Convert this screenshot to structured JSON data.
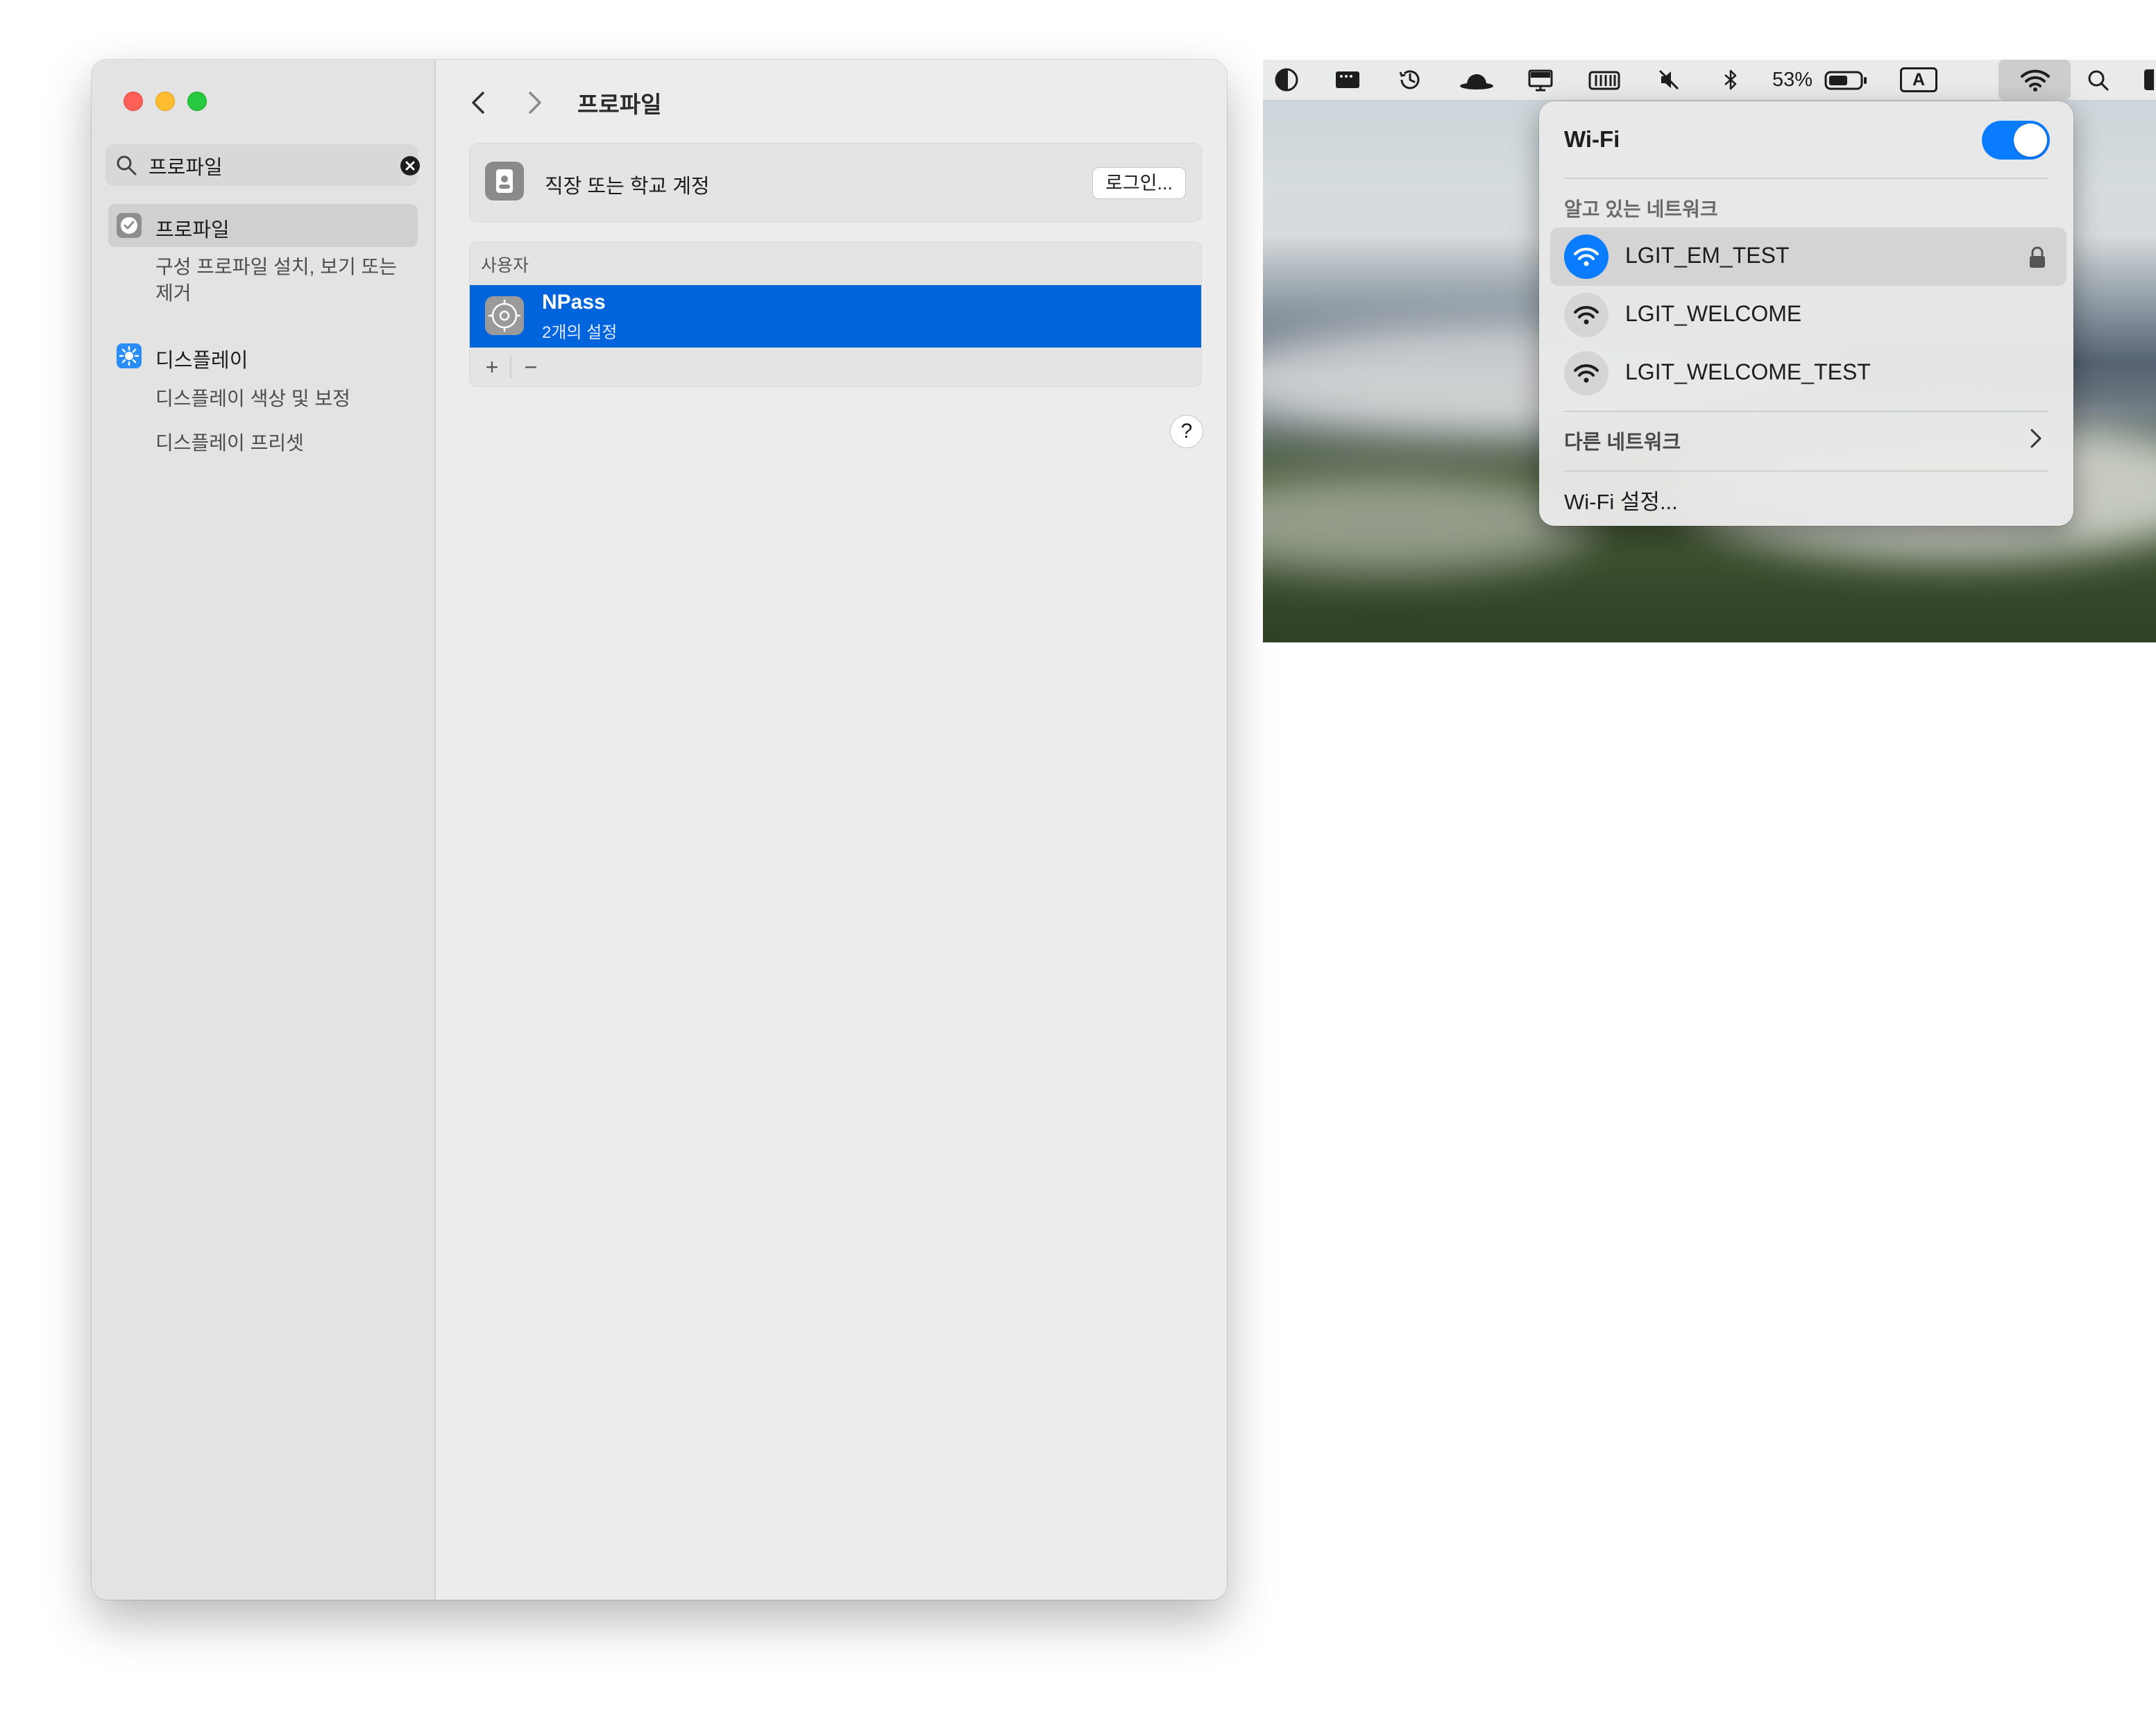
{
  "settings": {
    "search": {
      "value": "프로파일"
    },
    "sidebar": {
      "items": [
        {
          "label": "프로파일",
          "sub": [
            "구성 프로파일 설치, 보기 또는",
            "제거"
          ]
        },
        {
          "label": "디스플레이",
          "sub": [
            "디스플레이 색상 및 보정",
            "디스플레이 프리셋"
          ]
        }
      ]
    },
    "main": {
      "title": "프로파일",
      "account": {
        "label": "직장 또는 학교 계정",
        "button": "로그인..."
      },
      "section_header": "사용자",
      "profile": {
        "name": "NPass",
        "sub": "2개의 설정"
      },
      "add": "+",
      "remove": "−",
      "help": "?"
    }
  },
  "menubar": {
    "battery_percent": "53%",
    "input_source": "A",
    "icons": [
      "contrast-icon",
      "screen-capture-icon",
      "time-machine-icon",
      "bowler-hat-icon",
      "display-icon",
      "memory-icon",
      "mute-icon",
      "bluetooth-icon",
      "battery-icon",
      "input-source-icon",
      "wifi-icon",
      "spotlight-icon"
    ]
  },
  "wifi": {
    "title": "Wi-Fi",
    "enabled": true,
    "known_header": "알고 있는 네트워크",
    "networks": [
      {
        "name": "LGIT_EM_TEST",
        "connected": true,
        "locked": true
      },
      {
        "name": "LGIT_WELCOME",
        "connected": false,
        "locked": false
      },
      {
        "name": "LGIT_WELCOME_TEST",
        "connected": false,
        "locked": false
      }
    ],
    "other_networks": "다른 네트워크",
    "settings": "Wi-Fi 설정..."
  },
  "colors": {
    "accent": "#0a7cff",
    "selection": "#0064dc",
    "traffic_red": "#fe5f57",
    "traffic_yellow": "#febc2e",
    "traffic_green": "#28c840"
  }
}
